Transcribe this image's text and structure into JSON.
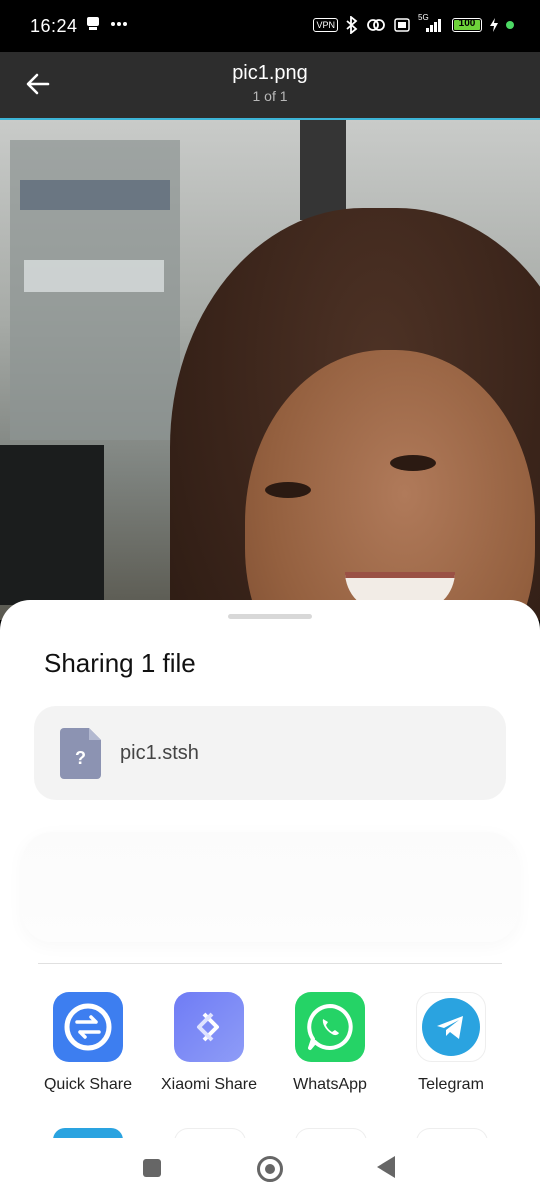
{
  "status_bar": {
    "time": "16:24",
    "notification_icons": [
      "app-notification-icon",
      "more-dots-icon"
    ],
    "vpn_label": "VPN",
    "network_label": "5G",
    "battery_level": "100",
    "right_icons": [
      "vpn-icon",
      "bluetooth-icon",
      "link-icon",
      "volte-icon",
      "signal-icon",
      "battery-icon",
      "charging-icon",
      "green-dot-indicator"
    ],
    "colors": {
      "battery": "#6ed43a",
      "dot": "#4cd964"
    }
  },
  "header": {
    "title": "pic1.png",
    "subtitle": "1 of 1",
    "back_icon": "arrow-left-icon",
    "accent_color": "#3db4d6"
  },
  "share_sheet": {
    "title": "Sharing 1 file",
    "file": {
      "name": "pic1.stsh",
      "icon": "unknown-file-icon",
      "icon_glyph": "?"
    },
    "apps": [
      {
        "label": "Quick Share",
        "icon": "quick-share-icon",
        "color": "#3d7ef0"
      },
      {
        "label": "Xiaomi Share",
        "icon": "xiaomi-share-icon",
        "color": "#7a86f3"
      },
      {
        "label": "WhatsApp",
        "icon": "whatsapp-icon",
        "color": "#25d366"
      },
      {
        "label": "Telegram",
        "icon": "telegram-icon",
        "color": "#2aa3e0"
      }
    ]
  },
  "nav_bar": {
    "buttons": [
      "recents-square-icon",
      "home-circle-icon",
      "back-triangle-icon"
    ]
  }
}
